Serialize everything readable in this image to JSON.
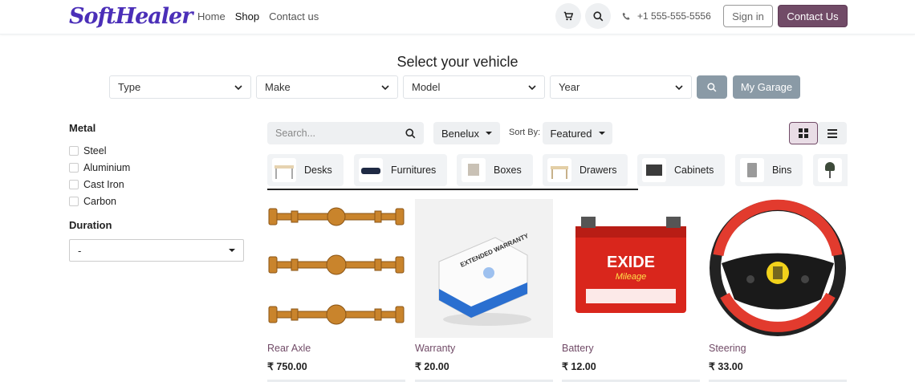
{
  "header": {
    "logo_text": "SoftHealer",
    "nav": [
      "Home",
      "Shop",
      "Contact us"
    ],
    "active_nav": "Shop",
    "phone": "+1 555-555-5556",
    "signin_label": "Sign in",
    "contact_label": "Contact Us"
  },
  "vehicle": {
    "title": "Select your vehicle",
    "selects": [
      "Type",
      "Make",
      "Model",
      "Year"
    ],
    "garage_label": "My Garage"
  },
  "filters": {
    "metal_title": "Metal",
    "metals": [
      "Steel",
      "Aluminium",
      "Cast Iron",
      "Carbon"
    ],
    "duration_title": "Duration",
    "duration_value": "-"
  },
  "toolbar": {
    "search_placeholder": "Search...",
    "pricelist": "Benelux",
    "sort_label": "Sort By:",
    "sort_value": "Featured"
  },
  "categories": [
    "Desks",
    "Furnitures",
    "Boxes",
    "Drawers",
    "Cabinets",
    "Bins",
    ""
  ],
  "products": [
    {
      "name": "Rear Axle",
      "price": "₹ 750.00"
    },
    {
      "name": "Warranty",
      "price": "₹ 20.00"
    },
    {
      "name": "Battery",
      "price": "₹ 12.00"
    },
    {
      "name": "Steering",
      "price": "₹ 33.00"
    }
  ],
  "warranty_box_text": "EXTENDED WARRANTY",
  "battery_brand": "EXIDE",
  "battery_sub": "Mileage",
  "colors": {
    "brand": "#714b67",
    "logo": "#4b2fb8",
    "muted_button": "#8a9aa6"
  }
}
